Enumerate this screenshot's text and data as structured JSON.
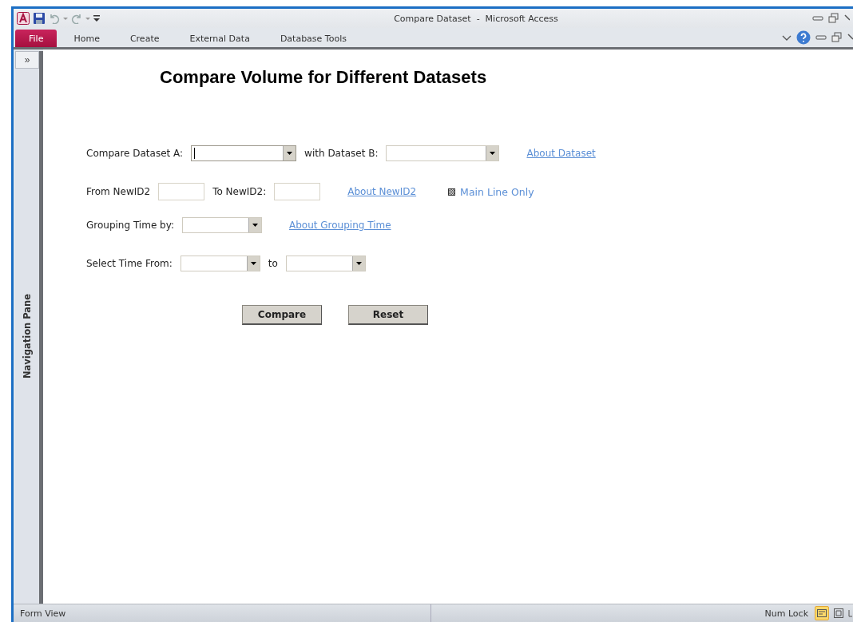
{
  "window": {
    "title": "Compare Dataset  -  Microsoft Access"
  },
  "ribbon": {
    "tabs": [
      {
        "label": "File",
        "selected": true
      },
      {
        "label": "Home",
        "selected": false
      },
      {
        "label": "Create",
        "selected": false
      },
      {
        "label": "External Data",
        "selected": false
      },
      {
        "label": "Database Tools",
        "selected": false
      }
    ]
  },
  "nav_pane": {
    "toggle": "»",
    "label": "Navigation Pane"
  },
  "form": {
    "title": "Compare Volume for Different Datasets",
    "rows": [
      {
        "items": [
          {
            "kind": "label",
            "text": "Compare Dataset A:"
          },
          {
            "kind": "combo",
            "focused": true
          },
          {
            "kind": "label",
            "text": "with Dataset B:"
          },
          {
            "kind": "combo",
            "focused": false
          },
          {
            "kind": "link",
            "text": "About Dataset"
          }
        ]
      },
      {
        "items": [
          {
            "kind": "label",
            "text": "From NewID2"
          },
          {
            "kind": "textbox"
          },
          {
            "kind": "label",
            "text": "To NewID2:"
          },
          {
            "kind": "textbox"
          },
          {
            "kind": "link",
            "text": "About NewID2"
          },
          {
            "kind": "checkbox",
            "indeterminate": true,
            "text": "Main Line Only"
          }
        ]
      },
      {
        "items": [
          {
            "kind": "label",
            "text": "Grouping Time by:"
          },
          {
            "kind": "combo",
            "focused": false
          },
          {
            "kind": "link",
            "text": "About Grouping Time"
          }
        ]
      },
      {
        "items": [
          {
            "kind": "label",
            "text": "Select Time From:"
          },
          {
            "kind": "combo",
            "focused": false
          },
          {
            "kind": "label",
            "text": "to"
          },
          {
            "kind": "combo",
            "focused": false
          }
        ]
      }
    ],
    "buttons": [
      "Compare",
      "Reset"
    ]
  },
  "status_bar": {
    "left": "Form View",
    "right": "Num Lock"
  }
}
